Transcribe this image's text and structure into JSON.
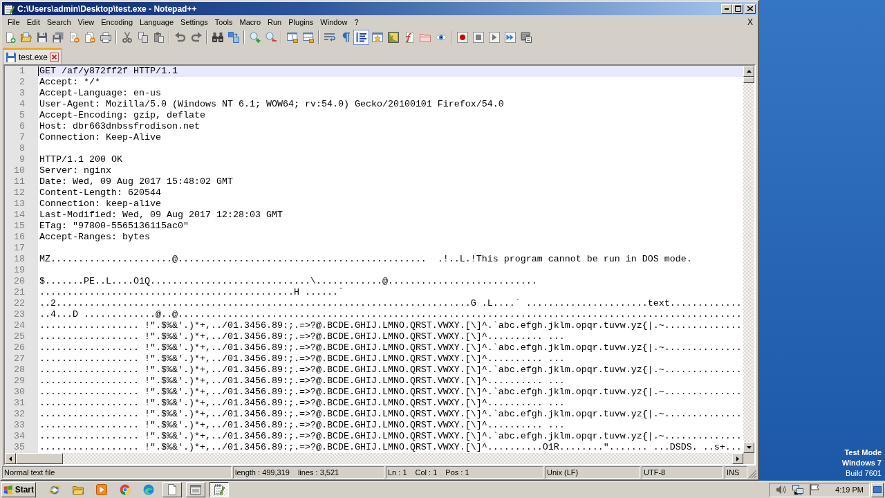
{
  "window": {
    "title": "C:\\Users\\admin\\Desktop\\test.exe - Notepad++"
  },
  "menu": {
    "items": [
      "File",
      "Edit",
      "Search",
      "View",
      "Encoding",
      "Language",
      "Settings",
      "Tools",
      "Macro",
      "Run",
      "Plugins",
      "Window",
      "?"
    ],
    "close": "X"
  },
  "toolbar": [
    {
      "buttons": [
        {
          "on": false
        },
        {
          "on": false
        },
        {
          "on": false
        },
        {
          "on": false
        },
        {
          "on": false
        },
        {
          "on": false
        },
        {
          "on": false
        }
      ]
    },
    {
      "buttons": [
        {
          "on": false
        },
        {
          "on": false
        },
        {
          "on": false
        }
      ]
    },
    {
      "buttons": [
        {
          "on": false
        },
        {
          "on": false
        }
      ]
    },
    {
      "buttons": [
        {
          "on": false
        },
        {
          "on": false
        }
      ]
    },
    {
      "buttons": [
        {
          "on": false
        },
        {
          "on": false
        }
      ]
    },
    {
      "buttons": [
        {
          "on": false
        },
        {
          "on": false
        }
      ]
    },
    {
      "buttons": [
        {
          "on": false
        },
        {
          "on": false
        },
        {
          "on": true
        },
        {
          "on": false
        },
        {
          "on": false
        },
        {
          "on": false
        },
        {
          "on": false
        },
        {
          "on": false
        }
      ]
    },
    {
      "buttons": [
        {
          "on": false
        },
        {
          "on": false
        },
        {
          "on": false
        },
        {
          "on": false
        },
        {
          "on": false
        }
      ]
    }
  ],
  "tabs": [
    {
      "label": "test.exe",
      "selected": true
    }
  ],
  "editor": {
    "lines": [
      {
        "number": "1",
        "text": "GET /af/y872ff2f HTTP/1.1",
        "current": true
      },
      {
        "number": "2",
        "text": "Accept: */*",
        "current": false
      },
      {
        "number": "3",
        "text": "Accept-Language: en-us",
        "current": false
      },
      {
        "number": "4",
        "text": "User-Agent: Mozilla/5.0 (Windows NT 6.1; WOW64; rv:54.0) Gecko/20100101 Firefox/54.0",
        "current": false
      },
      {
        "number": "5",
        "text": "Accept-Encoding: gzip, deflate",
        "current": false
      },
      {
        "number": "6",
        "text": "Host: dbr663dnbssfrodison.net",
        "current": false
      },
      {
        "number": "7",
        "text": "Connection: Keep-Alive",
        "current": false
      },
      {
        "number": "8",
        "current": false
      },
      {
        "number": "9",
        "text": "HTTP/1.1 200 OK",
        "current": false
      },
      {
        "number": "10",
        "text": "Server: nginx",
        "current": false
      },
      {
        "number": "11",
        "text": "Date: Wed, 09 Aug 2017 15:48:02 GMT",
        "current": false
      },
      {
        "number": "12",
        "text": "Content-Length: 620544",
        "current": false
      },
      {
        "number": "13",
        "text": "Connection: keep-alive",
        "current": false
      },
      {
        "number": "14",
        "text": "Last-Modified: Wed, 09 Aug 2017 12:28:03 GMT",
        "current": false
      },
      {
        "number": "15",
        "text": "ETag: \"97800-5565136115ac0\"",
        "current": false
      },
      {
        "number": "16",
        "text": "Accept-Ranges: bytes",
        "current": false
      },
      {
        "number": "17",
        "current": false
      },
      {
        "number": "18",
        "text": "MZ......................@.............................................  .!..L.!This program cannot be run in DOS mode.",
        "current": false
      },
      {
        "number": "19",
        "current": false
      },
      {
        "number": "20",
        "text": "$.......PE..L....O1Q.............................\\............@...........................",
        "current": false
      },
      {
        "number": "21",
        "text": "..............................................H ......`",
        "current": false
      },
      {
        "number": "22",
        "text": "..2...........................................................................G .L....` ......................text.............",
        "current": false
      },
      {
        "number": "23",
        "text": "..4...D .............@..@......................................................................................................",
        "current": false
      },
      {
        "number": "24",
        "text": ".................. !\".$%&'.)*+,../01.3456.89:;.=>?@.BCDE.GHIJ.LMNO.QRST.VWXY.[\\]^.`abc.efgh.jklm.opqr.tuvw.yz{|.~..............",
        "current": false
      },
      {
        "number": "25",
        "text": ".................. !\".$%&'.)*+,../01.3456.89:;.=>?@.BCDE.GHIJ.LMNO.QRST.VWXY.[\\]^.......... ...",
        "current": false
      },
      {
        "number": "26",
        "text": ".................. !\".$%&'.)*+,../01.3456.89:;.=>?@.BCDE.GHIJ.LMNO.QRST.VWXY.[\\]^.`abc.efgh.jklm.opqr.tuvw.yz{|.~..............",
        "current": false
      },
      {
        "number": "27",
        "text": ".................. !\".$%&'.)*+,../01.3456.89:;.=>?@.BCDE.GHIJ.LMNO.QRST.VWXY.[\\]^.......... ...",
        "current": false
      },
      {
        "number": "28",
        "text": ".................. !\".$%&'.)*+,../01.3456.89:;.=>?@.BCDE.GHIJ.LMNO.QRST.VWXY.[\\]^.`abc.efgh.jklm.opqr.tuvw.yz{|.~..............",
        "current": false
      },
      {
        "number": "29",
        "text": ".................. !\".$%&'.)*+,../01.3456.89:;.=>?@.BCDE.GHIJ.LMNO.QRST.VWXY.[\\]^.......... ...",
        "current": false
      },
      {
        "number": "30",
        "text": ".................. !\".$%&'.)*+,../01.3456.89:;.=>?@.BCDE.GHIJ.LMNO.QRST.VWXY.[\\]^.`abc.efgh.jklm.opqr.tuvw.yz{|.~..............",
        "current": false
      },
      {
        "number": "31",
        "text": ".................. !\".$%&'.)*+,../01.3456.89:;.=>?@.BCDE.GHIJ.LMNO.QRST.VWXY.[\\]^.......... ...",
        "current": false
      },
      {
        "number": "32",
        "text": ".................. !\".$%&'.)*+,../01.3456.89:;.=>?@.BCDE.GHIJ.LMNO.QRST.VWXY.[\\]^.`abc.efgh.jklm.opqr.tuvw.yz{|.~..............",
        "current": false
      },
      {
        "number": "33",
        "text": ".................. !\".$%&'.)*+,../01.3456.89:;.=>?@.BCDE.GHIJ.LMNO.QRST.VWXY.[\\]^.......... ...",
        "current": false
      },
      {
        "number": "34",
        "text": ".................. !\".$%&'.)*+,../01.3456.89:;.=>?@.BCDE.GHIJ.LMNO.QRST.VWXY.[\\]^.`abc.efgh.jklm.opqr.tuvw.yz{|.~..............",
        "current": false
      },
      {
        "number": "35",
        "text": ".................. !\".$%&'.)*+,../01.3456.89:;.=>?@.BCDE.GHIJ.LMNO.QRST.VWXY.[\\]^..........O1R........\"....... ...DSDS. ..s+...",
        "current": false
      }
    ]
  },
  "status_bar": {
    "file_type": "Normal text file",
    "length": "length : 499,319",
    "lines": "lines : 3,521",
    "line": "Ln : 1",
    "column": "Col : 1",
    "position": "Pos : 1",
    "eol": "Unix (LF)",
    "encoding": "UTF-8",
    "mode": "INS"
  },
  "desktop": {
    "notice": [
      "Test Mode",
      "Windows 7",
      "Build 7601"
    ]
  },
  "taskbar": {
    "start": "Start",
    "items": [
      {
        "kind": "launcher",
        "selected": false
      },
      {
        "kind": "launcher",
        "selected": false
      },
      {
        "kind": "launcher",
        "selected": false
      },
      {
        "kind": "launcher",
        "selected": false
      },
      {
        "kind": "launcher",
        "selected": false
      },
      {
        "kind": "window",
        "selected": false
      },
      {
        "kind": "window",
        "selected": false
      },
      {
        "kind": "window",
        "selected": true
      }
    ],
    "clock": "4:19 PM"
  }
}
